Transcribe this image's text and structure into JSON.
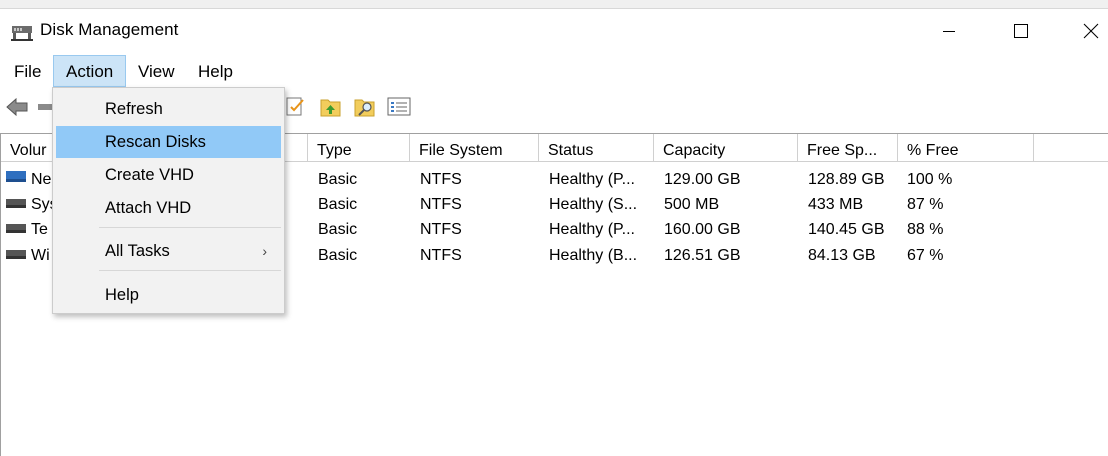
{
  "window": {
    "title": "Disk Management",
    "icon": "disk-management-icon"
  },
  "menubar": {
    "items": [
      {
        "label": "File"
      },
      {
        "label": "Action"
      },
      {
        "label": "View"
      },
      {
        "label": "Help"
      }
    ]
  },
  "action_menu": {
    "items": [
      {
        "label": "Refresh"
      },
      {
        "label": "Rescan Disks",
        "highlighted": true
      },
      {
        "label": "Create VHD"
      },
      {
        "label": "Attach VHD"
      },
      {
        "label": "All Tasks",
        "submenu_arrow": "›"
      },
      {
        "label": "Help"
      }
    ]
  },
  "list": {
    "columns": [
      {
        "label": "Volur"
      },
      {
        "label": "Type"
      },
      {
        "label": "File System"
      },
      {
        "label": "Status"
      },
      {
        "label": "Capacity"
      },
      {
        "label": "Free Sp..."
      },
      {
        "label": "% Free"
      }
    ],
    "rows": [
      {
        "volume": "Ne",
        "type": "Basic",
        "fs": "NTFS",
        "status": "Healthy (P...",
        "capacity": "129.00 GB",
        "free": "128.89 GB",
        "pct": "100 %"
      },
      {
        "volume": "Sys",
        "type": "Basic",
        "fs": "NTFS",
        "status": "Healthy (S...",
        "capacity": "500 MB",
        "free": "433 MB",
        "pct": "87 %"
      },
      {
        "volume": "Te",
        "type": "Basic",
        "fs": "NTFS",
        "status": "Healthy (P...",
        "capacity": "160.00 GB",
        "free": "140.45 GB",
        "pct": "88 %"
      },
      {
        "volume": "Wi",
        "type": "Basic",
        "fs": "NTFS",
        "status": "Healthy (B...",
        "capacity": "126.51 GB",
        "free": "84.13 GB",
        "pct": "67 %"
      }
    ]
  },
  "colors": {
    "menu_highlight": "#91c9f7",
    "menubar_active": "#cce4f7"
  }
}
